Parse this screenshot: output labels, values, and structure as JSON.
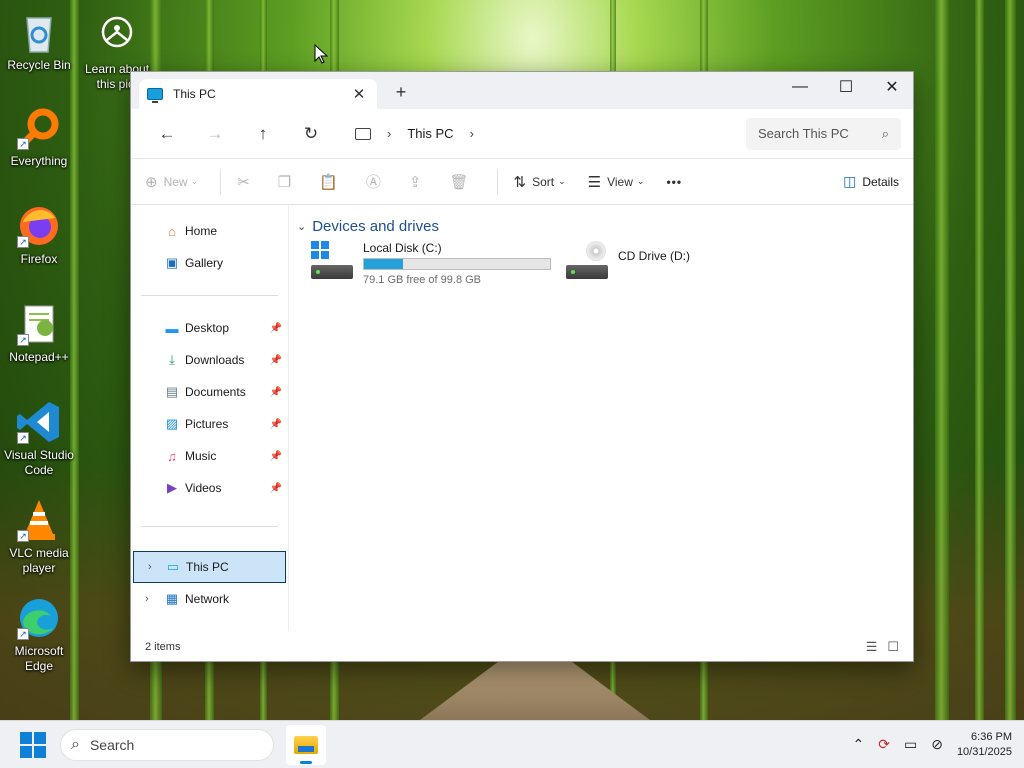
{
  "desktop": {
    "icons": [
      {
        "label": "Recycle Bin",
        "icon": "recycle-bin-icon"
      },
      {
        "label": "Learn about this pict",
        "icon": "learn-about-picture-icon"
      },
      {
        "label": "Everything",
        "icon": "everything-search-icon"
      },
      {
        "label": "Firefox",
        "icon": "firefox-icon"
      },
      {
        "label": "Notepad++",
        "icon": "notepad-plus-plus-icon"
      },
      {
        "label": "Visual Studio Code",
        "icon": "vscode-icon"
      },
      {
        "label": "VLC media player",
        "icon": "vlc-icon"
      },
      {
        "label": "Microsoft Edge",
        "icon": "edge-icon"
      }
    ]
  },
  "window": {
    "tab_title": "This PC",
    "tab_close": "✕",
    "new_tab": "+",
    "minimize": "—",
    "maximize": "☐",
    "close": "✕"
  },
  "nav": {
    "back": "←",
    "forward": "→",
    "up": "↑",
    "refresh": "↻",
    "breadcrumb": "This PC",
    "chevron": "›",
    "search_placeholder": "Search This PC",
    "search_icon": "⌕"
  },
  "commands": {
    "new": "New",
    "sort": "Sort",
    "view": "View",
    "more": "•••",
    "details": "Details"
  },
  "sidebar": {
    "top": [
      {
        "label": "Home",
        "icon": "home-icon"
      },
      {
        "label": "Gallery",
        "icon": "gallery-icon"
      }
    ],
    "pinned": [
      {
        "label": "Desktop",
        "icon": "desktop-folder-icon"
      },
      {
        "label": "Downloads",
        "icon": "downloads-icon"
      },
      {
        "label": "Documents",
        "icon": "documents-icon"
      },
      {
        "label": "Pictures",
        "icon": "pictures-icon"
      },
      {
        "label": "Music",
        "icon": "music-icon"
      },
      {
        "label": "Videos",
        "icon": "videos-icon"
      }
    ],
    "tree": [
      {
        "label": "This PC",
        "icon": "this-pc-icon",
        "selected": true
      },
      {
        "label": "Network",
        "icon": "network-icon",
        "selected": false
      }
    ]
  },
  "content": {
    "group_title": "Devices and drives",
    "drives": [
      {
        "name": "Local Disk (C:)",
        "free_text": "79.1 GB free of 99.8 GB",
        "used_fraction": 0.207,
        "icon": "local-disk-icon"
      },
      {
        "name": "CD Drive (D:)",
        "icon": "cd-drive-icon"
      }
    ]
  },
  "status": {
    "item_count": "2 items"
  },
  "taskbar": {
    "search_label": "Search",
    "time": "6:36 PM",
    "date": "10/31/2025"
  },
  "colors": {
    "accent": "#0f7fd8",
    "group_header": "#1d4f91",
    "selection": "#cce4f7",
    "drive_bar": "#26a0da"
  }
}
